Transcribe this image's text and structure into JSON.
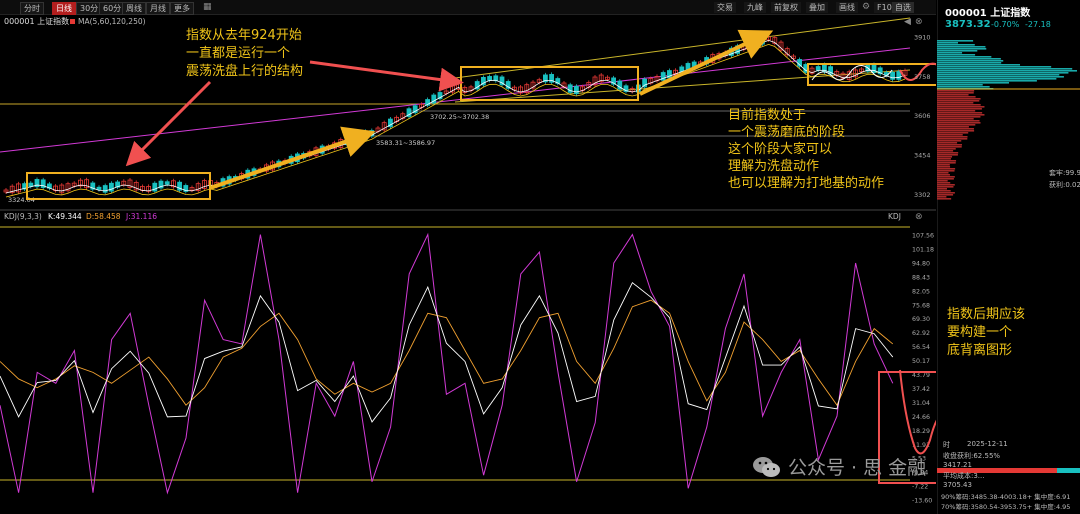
{
  "toolbar": {
    "tabs": [
      "分时",
      "日线",
      "30分",
      "60分",
      "周线",
      "月线",
      "更多"
    ],
    "active_tab": "日线",
    "right_buttons": [
      "交易",
      "九峰",
      "前复权",
      "叠加",
      "画线",
      "F10",
      "自选"
    ]
  },
  "main_chart": {
    "title": "000001 上证指数",
    "ma_label": "MA(5,60,120,250)",
    "price_ticks": [
      "3910",
      "3758",
      "3606",
      "3454",
      "3302"
    ],
    "price_range": [
      3260,
      4000
    ],
    "labels": {
      "low": "3324.04",
      "range1": "3583.31~3586.97",
      "range2": "3702.25~3702.38"
    }
  },
  "kdj_panel": {
    "label": "KDJ(9,3,3)",
    "k_label": "K:49.344",
    "d_label": "D:58.458",
    "j_label": "J:31.116",
    "right_label": "KDJ",
    "ticks": [
      "107.56",
      "101.18",
      "94.80",
      "88.43",
      "82.05",
      "75.68",
      "69.30",
      "62.92",
      "56.54",
      "50.17",
      "43.79",
      "37.42",
      "31.04",
      "24.66",
      "18.29",
      "11.91",
      "5.53",
      "-0.84",
      "-7.22",
      "-13.60"
    ],
    "range": [
      -17,
      111
    ],
    "j_points": [
      [
        0,
        30
      ],
      [
        6,
        -10
      ],
      [
        12,
        45
      ],
      [
        18,
        40
      ],
      [
        24,
        55
      ],
      [
        30,
        -10
      ],
      [
        36,
        60
      ],
      [
        42,
        72
      ],
      [
        48,
        30
      ],
      [
        54,
        -10
      ],
      [
        60,
        15
      ],
      [
        66,
        78
      ],
      [
        72,
        60
      ],
      [
        78,
        58
      ],
      [
        84,
        108
      ],
      [
        90,
        60
      ],
      [
        96,
        -10
      ],
      [
        102,
        40
      ],
      [
        108,
        25
      ],
      [
        114,
        50
      ],
      [
        120,
        -5
      ],
      [
        126,
        20
      ],
      [
        132,
        90
      ],
      [
        138,
        108
      ],
      [
        144,
        35
      ],
      [
        150,
        40
      ],
      [
        156,
        -2
      ],
      [
        162,
        30
      ],
      [
        168,
        90
      ],
      [
        174,
        100
      ],
      [
        180,
        45
      ],
      [
        186,
        -5
      ],
      [
        192,
        22
      ],
      [
        198,
        95
      ],
      [
        204,
        108
      ],
      [
        210,
        82
      ],
      [
        216,
        66
      ],
      [
        222,
        -8
      ],
      [
        228,
        20
      ],
      [
        234,
        65
      ],
      [
        240,
        90
      ],
      [
        246,
        25
      ],
      [
        252,
        45
      ],
      [
        258,
        60
      ],
      [
        264,
        5
      ],
      [
        270,
        25
      ],
      [
        276,
        95
      ],
      [
        282,
        58
      ],
      [
        288,
        40
      ]
    ],
    "d_points": [
      [
        0,
        50
      ],
      [
        6,
        42
      ],
      [
        12,
        38
      ],
      [
        18,
        42
      ],
      [
        24,
        48
      ],
      [
        30,
        45
      ],
      [
        36,
        40
      ],
      [
        42,
        46
      ],
      [
        48,
        52
      ],
      [
        54,
        42
      ],
      [
        60,
        30
      ],
      [
        66,
        38
      ],
      [
        72,
        52
      ],
      [
        78,
        56
      ],
      [
        84,
        66
      ],
      [
        90,
        72
      ],
      [
        96,
        60
      ],
      [
        102,
        42
      ],
      [
        108,
        35
      ],
      [
        114,
        40
      ],
      [
        120,
        36
      ],
      [
        126,
        40
      ],
      [
        132,
        55
      ],
      [
        138,
        72
      ],
      [
        144,
        70
      ],
      [
        150,
        55
      ],
      [
        156,
        40
      ],
      [
        162,
        42
      ],
      [
        168,
        55
      ],
      [
        174,
        70
      ],
      [
        180,
        72
      ],
      [
        186,
        50
      ],
      [
        192,
        40
      ],
      [
        198,
        56
      ],
      [
        204,
        75
      ],
      [
        210,
        78
      ],
      [
        216,
        72
      ],
      [
        222,
        50
      ],
      [
        228,
        32
      ],
      [
        234,
        45
      ],
      [
        240,
        68
      ],
      [
        246,
        60
      ],
      [
        252,
        50
      ],
      [
        258,
        55
      ],
      [
        264,
        42
      ],
      [
        270,
        30
      ],
      [
        276,
        50
      ],
      [
        282,
        65
      ],
      [
        288,
        58
      ]
    ]
  },
  "annotations": {
    "a1_line1": "指数从去年924开始",
    "a1_line2": "一直都是运行一个",
    "a1_line3": "震荡洗盘上行的结构",
    "a2_line1": "目前指数处于",
    "a2_line2": "一个震荡磨底的阶段",
    "a2_line3": "这个阶段大家可以",
    "a2_line4": "理解为洗盘动作",
    "a2_line5": "也可以理解为打地基的动作",
    "a3_line1": "指数后期应该",
    "a3_line2": "要构建一个",
    "a3_line3": "底背离图形"
  },
  "right_panel": {
    "code": "000001 上证指数",
    "price": "3873.32",
    "change_pct": "-0.70%",
    "change_val": "-27.18",
    "stat1": "套牢:99.9",
    "stat2": "获利:0.02",
    "date_label": "时",
    "date_value": "2025-12-11",
    "profit": "收盘获利:62.55%",
    "line3": "3417.21",
    "line4": "平均成本:3...",
    "line5": "3705.43",
    "cost90": "90%筹码:3485.38-4003.18+ 集中度:6.91",
    "cost70": "70%筹码:3580.54-3953.75+ 集中度:4.95"
  },
  "watermark": {
    "text": "公众号 · 思   金融"
  },
  "colors": {
    "up": "#e53935",
    "down": "#19c0c0",
    "ma_white": "#ffffff",
    "ma_yellow": "#f0c419",
    "ma_magenta": "#d23ad6",
    "arrow_red": "#f05050",
    "arrow_yellow": "#f0b020",
    "box_yellow": "#f0b020"
  }
}
